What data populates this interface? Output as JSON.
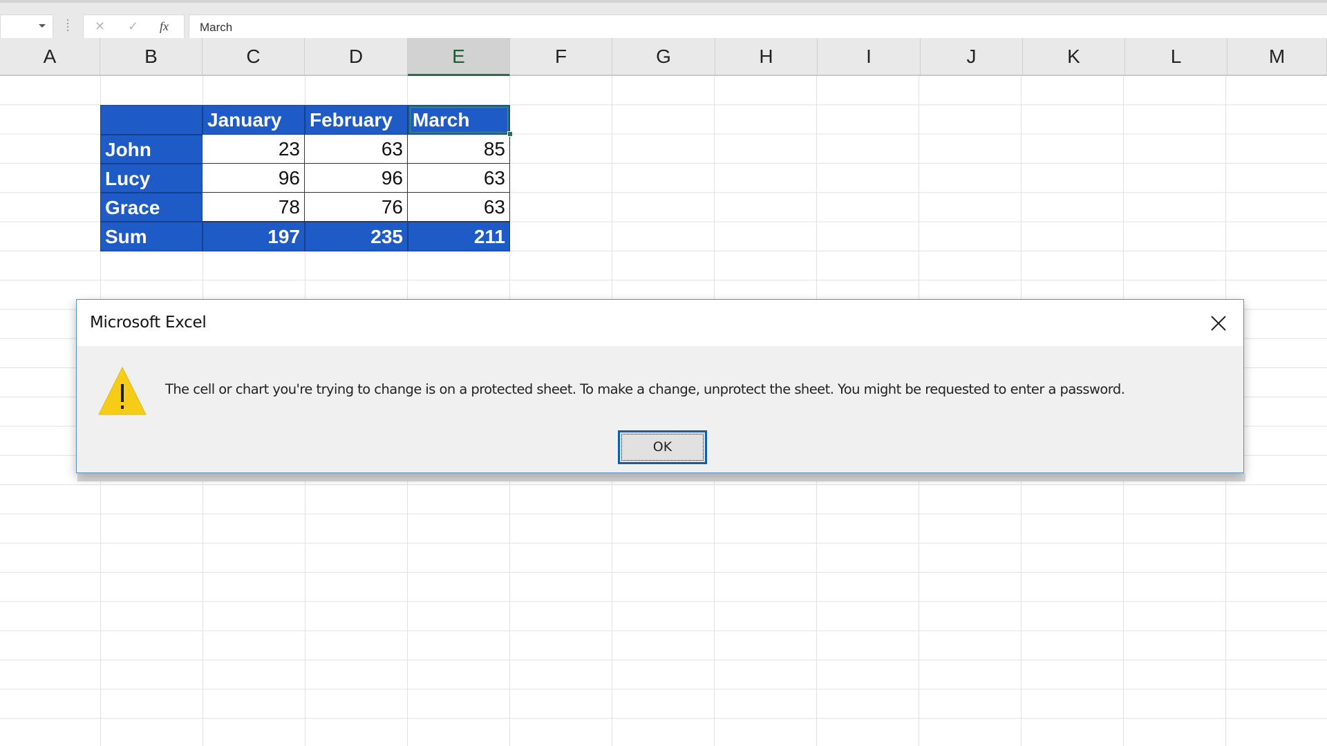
{
  "formula_bar": {
    "name_box_value": "",
    "cancel_icon": "✕",
    "enter_icon": "✓",
    "fx_label": "fx",
    "formula_value": "March"
  },
  "columns": [
    "A",
    "B",
    "C",
    "D",
    "E",
    "F",
    "G",
    "H",
    "I",
    "J",
    "K",
    "L",
    "M"
  ],
  "selected_column": "E",
  "table": {
    "header": [
      "",
      "January",
      "February",
      "March"
    ],
    "rows": [
      {
        "name": "John",
        "values": [
          "23",
          "63",
          "85"
        ]
      },
      {
        "name": "Lucy",
        "values": [
          "96",
          "96",
          "63"
        ]
      },
      {
        "name": "Grace",
        "values": [
          "78",
          "76",
          "63"
        ]
      }
    ],
    "sum_row": {
      "name": "Sum",
      "values": [
        "197",
        "235",
        "211"
      ]
    }
  },
  "dialog": {
    "title": "Microsoft Excel",
    "message": "The cell or chart you're trying to change is on a protected sheet. To make a change, unprotect the sheet. You might be requested to enter a password.",
    "ok_label": "OK",
    "icon": "warning-icon"
  },
  "colors": {
    "table_blue": "#1f5bc6",
    "excel_green": "#217346",
    "warning_yellow": "#f6cc16",
    "ok_border": "#0a5fb3"
  }
}
